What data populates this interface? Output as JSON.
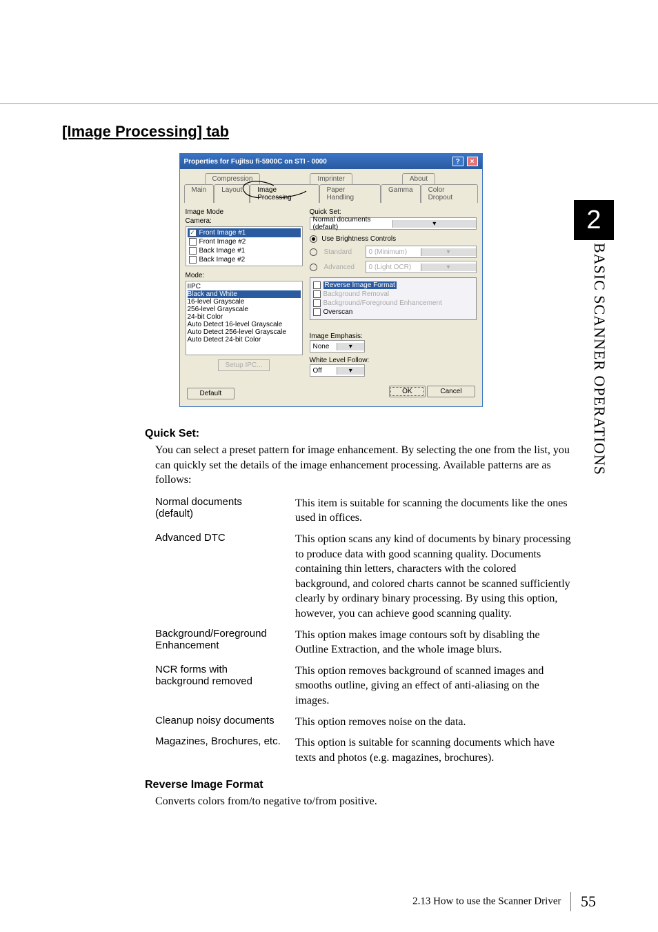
{
  "sidebar": {
    "chapter_number": "2",
    "chapter_title": "BASIC SCANNER OPERATIONS"
  },
  "heading": "[Image Processing] tab",
  "dialog": {
    "title": "Properties for Fujitsu fi-5900C on STI - 0000",
    "tabs_row1": [
      "Compression",
      "Imprinter",
      "About"
    ],
    "tabs_row2": [
      "Main",
      "Layout",
      "Image Processing",
      "Paper Handling",
      "Gamma",
      "Color Dropout"
    ],
    "left": {
      "image_mode_label": "Image Mode",
      "camera_label": "Camera:",
      "camera_items": [
        {
          "label": "Front Image #1",
          "checked": true,
          "selected": true
        },
        {
          "label": "Front Image #2",
          "checked": false,
          "selected": false
        },
        {
          "label": "Back Image #1",
          "checked": false,
          "selected": false
        },
        {
          "label": "Back Image #2",
          "checked": false,
          "selected": false
        }
      ],
      "mode_label": "Mode:",
      "mode_items": [
        "IIPC",
        "Black and White",
        "16-level Grayscale",
        "256-level Grayscale",
        "24-bit Color",
        "Auto Detect 16-level Grayscale",
        "Auto Detect 256-level Grayscale",
        "Auto Detect 24-bit Color"
      ],
      "mode_selected_index": 1,
      "setup_btn": "Setup IPC..."
    },
    "right": {
      "quickset_label": "Quick Set:",
      "quickset_value": "Normal documents (default)",
      "use_brightness": "Use Brightness Controls",
      "standard": "Standard",
      "standard_val": "0 (Minimum)",
      "advanced": "Advanced",
      "advanced_val": "0 (Light OCR)",
      "enh_items": [
        {
          "label": "Reverse Image Format",
          "selected": true
        },
        {
          "label": "Background Removal",
          "selected": false,
          "faded": true
        },
        {
          "label": "Background/Foreground Enhancement",
          "selected": false,
          "faded": true
        },
        {
          "label": "Overscan",
          "selected": false
        }
      ],
      "image_emphasis_label": "Image Emphasis:",
      "image_emphasis_value": "None",
      "white_level_label": "White Level Follow:",
      "white_level_value": "Off"
    },
    "footer": {
      "default_btn": "Default",
      "ok_btn": "OK",
      "cancel_btn": "Cancel"
    }
  },
  "content": {
    "quick_set_heading": "Quick Set:",
    "quick_set_para": "You can select a preset pattern for image enhancement. By selecting the one from the list, you can quickly set the details of the image enhancement processing. Available patterns are as follows:",
    "items": [
      {
        "term": "Normal documents (default)",
        "desc": "This item is suitable for scanning the documents like the ones used in offices."
      },
      {
        "term": "Advanced DTC",
        "desc": "This option scans any kind of documents by binary processing to produce data with good scanning quality.\nDocuments containing thin letters, characters with the colored background, and colored charts cannot be scanned sufficiently clearly by ordinary binary processing. By using this option, however, you can achieve good scanning quality."
      },
      {
        "term": "Background/Foreground Enhancement",
        "desc": "This option makes image contours soft by disabling the Outline Extraction, and the whole image blurs."
      },
      {
        "term": "NCR forms with background removed",
        "desc": "This option removes background of scanned images and smooths outline, giving an effect of anti-aliasing on the images."
      },
      {
        "term": "Cleanup noisy documents",
        "desc": "This option removes noise on the data."
      },
      {
        "term": "Magazines, Brochures, etc.",
        "desc": "This option is suitable for scanning documents which have texts and photos (e.g. magazines, brochures)."
      }
    ],
    "reverse_heading": "Reverse Image Format",
    "reverse_para": "Converts colors from/to negative to/from positive."
  },
  "footer": {
    "text": "2.13 How to use the Scanner Driver",
    "page": "55"
  }
}
